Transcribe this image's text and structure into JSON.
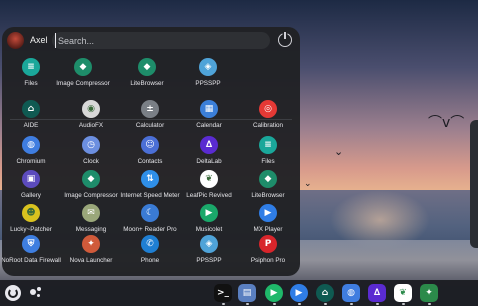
{
  "launcher": {
    "user_name": "Axel",
    "search_placeholder": "Search...",
    "suggested": [
      {
        "label": "Files",
        "icon": "files-icon",
        "color": "#1aa79a"
      },
      {
        "label": "Image Compressor",
        "icon": "android-icon",
        "color": "#1e8d6a"
      },
      {
        "label": "LiteBrowser",
        "icon": "android-icon",
        "color": "#1e8d6a"
      },
      {
        "label": "PPSSPP",
        "icon": "ppsspp-icon",
        "color": "#4fa3d8"
      }
    ],
    "apps": [
      {
        "label": "AIDE",
        "icon": "aide-icon",
        "color": "#0f5a52"
      },
      {
        "label": "AudioFX",
        "icon": "audiofx-icon",
        "color": "#d8d8d8"
      },
      {
        "label": "Calculator",
        "icon": "calculator-icon",
        "color": "#7a7f86"
      },
      {
        "label": "Calendar",
        "icon": "calendar-icon",
        "color": "#3b7fd9"
      },
      {
        "label": "Calibration",
        "icon": "calibration-icon",
        "color": "#e53935"
      },
      {
        "label": "Chromium",
        "icon": "chromium-icon",
        "color": "#3f7de0"
      },
      {
        "label": "Clock",
        "icon": "clock-icon",
        "color": "#6c8fe0"
      },
      {
        "label": "Contacts",
        "icon": "contacts-icon",
        "color": "#4b6fd6"
      },
      {
        "label": "DeltaLab",
        "icon": "deltalab-icon",
        "color": "#5a2bd1"
      },
      {
        "label": "Files",
        "icon": "files-icon",
        "color": "#1aa79a"
      },
      {
        "label": "Gallery",
        "icon": "gallery-icon",
        "color": "#5c4bbd"
      },
      {
        "label": "Image Compressor",
        "icon": "android-icon",
        "color": "#1e8d6a"
      },
      {
        "label": "Internet Speed Meter",
        "icon": "speed-meter-icon",
        "color": "#2f8fe8"
      },
      {
        "label": "LeafPic Revived",
        "icon": "leafpic-icon",
        "color": "#ffffff"
      },
      {
        "label": "LiteBrowser",
        "icon": "android-icon",
        "color": "#1e8d6a"
      },
      {
        "label": "Lucky~Patcher",
        "icon": "lucky-patcher-icon",
        "color": "#d9c21f"
      },
      {
        "label": "Messaging",
        "icon": "messaging-icon",
        "color": "#9aa77a"
      },
      {
        "label": "Moon+ Reader Pro",
        "icon": "moon-reader-icon",
        "color": "#3a7bd5"
      },
      {
        "label": "Musicolet",
        "icon": "musicolet-icon",
        "color": "#1aa86a"
      },
      {
        "label": "MX Player",
        "icon": "mx-player-icon",
        "color": "#2f7de6"
      },
      {
        "label": "NoRoot Data Firewall",
        "icon": "firewall-icon",
        "color": "#3e7ee0"
      },
      {
        "label": "Nova Launcher",
        "icon": "nova-icon",
        "color": "#d05a3a"
      },
      {
        "label": "Phone",
        "icon": "phone-icon",
        "color": "#1f7fd3"
      },
      {
        "label": "PPSSPP",
        "icon": "ppsspp-icon",
        "color": "#4fa3d8"
      },
      {
        "label": "Psiphon Pro",
        "icon": "psiphon-icon",
        "color": "#d8252b"
      }
    ]
  },
  "shelf": {
    "apps": [
      {
        "name": "terminal-icon",
        "color": "#111111"
      },
      {
        "name": "file-manager-icon",
        "color": "#5a7fc0"
      },
      {
        "name": "play-store-icon",
        "color": "#1fb86a"
      },
      {
        "name": "mx-player-icon",
        "color": "#2f7de6"
      },
      {
        "name": "aide-icon",
        "color": "#0f5a52"
      },
      {
        "name": "chromium-icon",
        "color": "#3f7de0"
      },
      {
        "name": "deltalab-icon",
        "color": "#5a2bd1"
      },
      {
        "name": "leafpic-icon",
        "color": "#ffffff"
      },
      {
        "name": "android-green-icon",
        "color": "#2b8a4a"
      }
    ]
  }
}
